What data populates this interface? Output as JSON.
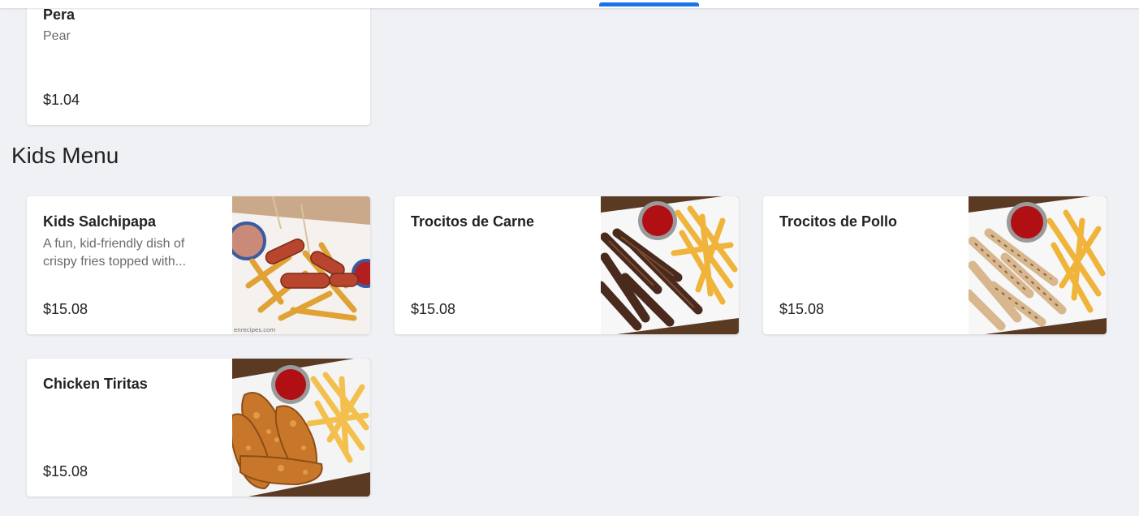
{
  "top_bar": {
    "indicator_color": "#1a73e8"
  },
  "previous_item": {
    "name": "Pera",
    "description": "Pear",
    "price": "$1.04"
  },
  "section": {
    "title": "Kids Menu",
    "items": [
      {
        "name": "Kids Salchipapa",
        "description": "A fun, kid-friendly dish of crispy fries topped with...",
        "price": "$15.08",
        "image_icon": "salchipapa-photo",
        "watermark": "enrecipes.com"
      },
      {
        "name": "Trocitos de Carne",
        "description": "",
        "price": "$15.08",
        "image_icon": "steak-strips-photo"
      },
      {
        "name": "Trocitos de Pollo",
        "description": "",
        "price": "$15.08",
        "image_icon": "chicken-strips-photo"
      },
      {
        "name": "Chicken Tiritas",
        "description": "",
        "price": "$15.08",
        "image_icon": "fried-chicken-tenders-photo"
      }
    ]
  }
}
